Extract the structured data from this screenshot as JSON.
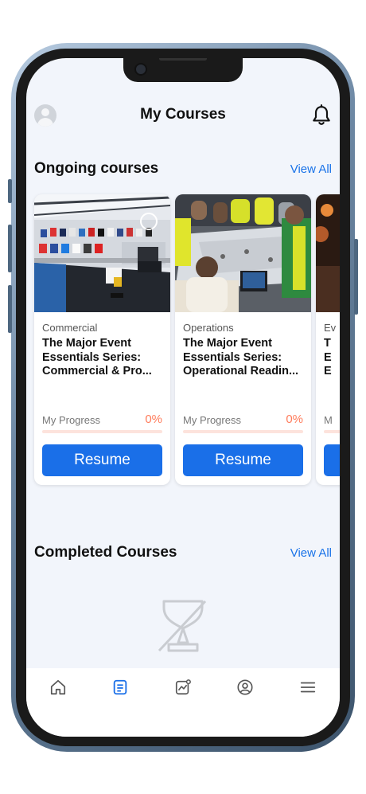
{
  "header": {
    "title": "My Courses"
  },
  "ongoing": {
    "title": "Ongoing courses",
    "view_all": "View All",
    "courses": [
      {
        "category": "Commercial",
        "title": "The Major Event Essentials Series: Commercial & Pro...",
        "progress_label": "My Progress",
        "progress_value": "0%",
        "progress": 0,
        "button": "Resume"
      },
      {
        "category": "Operations",
        "title": "The Major Event Essentials Series: Operational Readin...",
        "progress_label": "My Progress",
        "progress_value": "0%",
        "progress": 0,
        "button": "Resume"
      },
      {
        "category": "Ev",
        "title": "T E E",
        "progress_label": "M",
        "progress_value": "",
        "progress": 0,
        "button": ""
      }
    ]
  },
  "completed": {
    "title": "Completed Courses",
    "view_all": "View All"
  },
  "colors": {
    "accent": "#1a6fe8",
    "link": "#1a73e8",
    "progress": "#ff7b5a",
    "screen_bg": "#f2f5fb"
  },
  "nav": {
    "items": [
      {
        "icon": "home-icon",
        "active": false
      },
      {
        "icon": "courses-icon",
        "active": true
      },
      {
        "icon": "analytics-icon",
        "active": false
      },
      {
        "icon": "profile-icon",
        "active": false
      },
      {
        "icon": "menu-icon",
        "active": false
      }
    ]
  }
}
